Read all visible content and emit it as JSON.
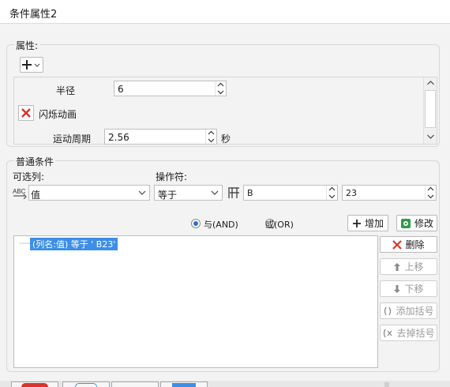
{
  "window": {
    "title": "条件属性2"
  },
  "attributes": {
    "label": "属性:",
    "add_button_icon": "plus-dropdown-icon",
    "radius": {
      "label": "半径",
      "value": "6"
    },
    "flash": {
      "label": "闪烁动画"
    },
    "period": {
      "label": "运动周期",
      "value": "2.56",
      "unit": "秒"
    }
  },
  "conditions": {
    "label": "普通条件",
    "column_label": "可选列:",
    "operator_label": "操作符:",
    "column_value": "值",
    "operator_value": "等于",
    "cell_value": "B",
    "number_value": "23",
    "and_label": "与(AND)",
    "or_label": "或(OR)",
    "add_button": "增加",
    "modify_button": "修改",
    "condition_item": "(列名:值) 等于 ' B23'",
    "delete_button": "删除",
    "up_button": "上移",
    "down_button": "下移",
    "add_bracket_button": "添加括号",
    "remove_bracket_button": "去掉括号"
  },
  "colors": {
    "accent_blue": "#3d8ee8",
    "delete_red": "#d9342b",
    "modify_green": "#2f9b48"
  }
}
